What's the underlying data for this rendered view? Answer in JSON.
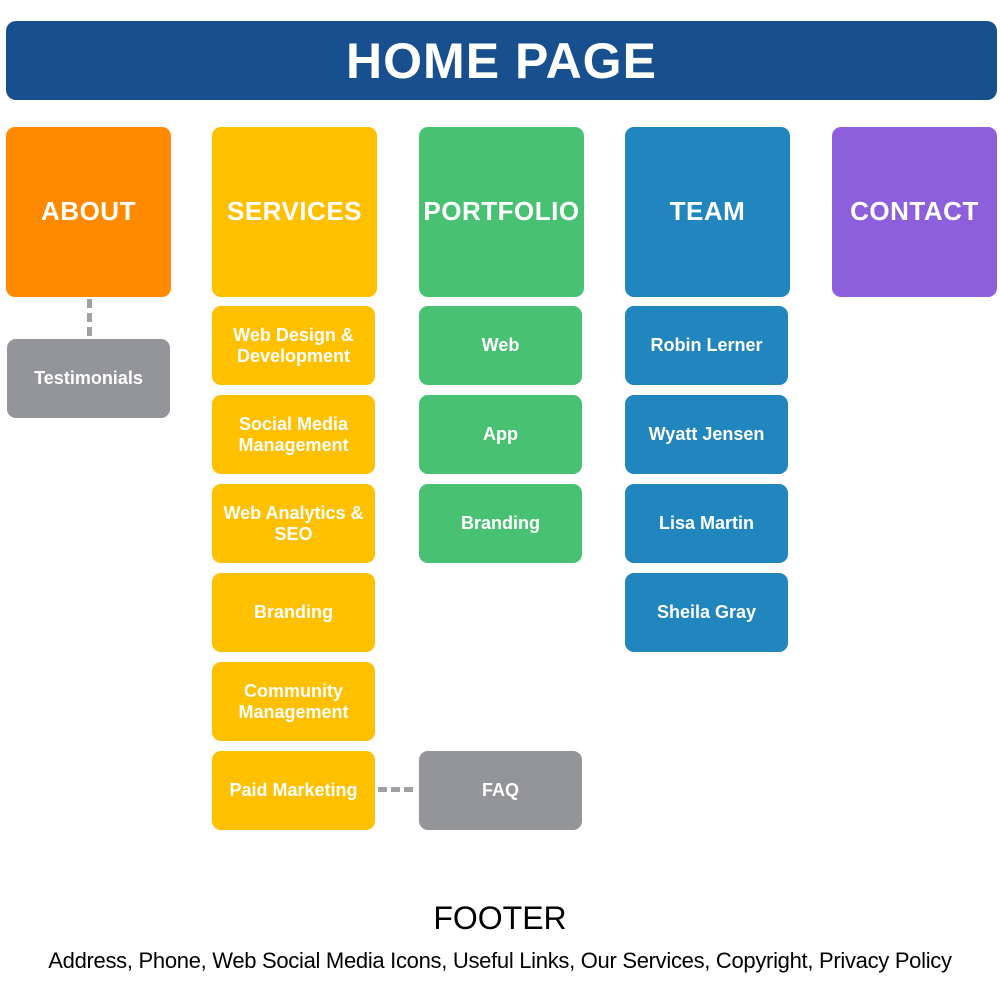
{
  "header": {
    "title": "HOME PAGE",
    "color": "#184f8f"
  },
  "columns": [
    {
      "label": "ABOUT",
      "color": "#ff8a00",
      "children": [],
      "linked": [
        "Testimonials"
      ]
    },
    {
      "label": "SERVICES",
      "color": "#ffc000",
      "children": [
        "Web Design & Development",
        "Social Media Management",
        "Web Analytics & SEO",
        "Branding",
        "Community Management",
        "Paid Marketing"
      ]
    },
    {
      "label": "PORTFOLIO",
      "color": "#48c172",
      "children": [
        "Web",
        "App",
        "Branding"
      ]
    },
    {
      "label": "TEAM",
      "color": "#2185be",
      "children": [
        "Robin Lerner",
        "Wyatt Jensen",
        "Lisa Martin",
        "Sheila Gray"
      ]
    },
    {
      "label": "CONTACT",
      "color": "#8e5fdc",
      "children": []
    }
  ],
  "extras": {
    "testimonials": "Testimonials",
    "faq": "FAQ",
    "gray_color": "#939598"
  },
  "footer": {
    "title": "FOOTER",
    "items": "Address, Phone, Web Social Media Icons, Useful Links, Our Services, Copyright, Privacy Policy"
  }
}
